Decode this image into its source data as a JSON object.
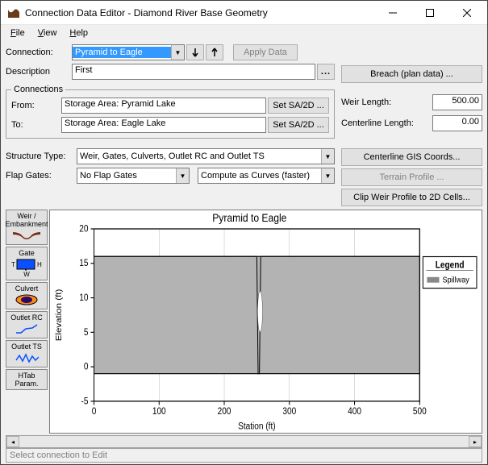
{
  "window": {
    "title": "Connection Data Editor - Diamond River Base Geometry"
  },
  "menu": {
    "file": "File",
    "view": "View",
    "help": "Help"
  },
  "labels": {
    "connection": "Connection:",
    "description": "Description",
    "connections": "Connections",
    "from": "From:",
    "to": "To:",
    "weir_length": "Weir Length:",
    "centerline_length": "Centerline Length:",
    "structure_type": "Structure Type:",
    "flap_gates": "Flap Gates:"
  },
  "fields": {
    "connection": "Pyramid to Eagle",
    "description": "First",
    "from": "Storage Area: Pyramid Lake",
    "to": "Storage Area: Eagle Lake",
    "weir_length": "500.00",
    "centerline_length": "0.00",
    "structure_type": "Weir, Gates, Culverts, Outlet RC and Outlet TS",
    "flap_gates": "No Flap Gates",
    "compute_mode": "Compute as Curves (faster)"
  },
  "buttons": {
    "apply_data": "Apply Data",
    "breach": "Breach (plan data) ...",
    "set_sa2d": "Set SA/2D ...",
    "centerline_gis": "Centerline GIS Coords...",
    "terrain_profile": "Terrain Profile ...",
    "clip_weir": "Clip Weir Profile to 2D Cells..."
  },
  "tools": {
    "weir": "Weir / Embankment",
    "gate": "Gate",
    "culvert": "Culvert",
    "outlet_rc": "Outlet RC",
    "outlet_ts": "Outlet TS",
    "htab": "HTab Param."
  },
  "status": "Select connection to Edit",
  "chart_data": {
    "type": "line",
    "title": "Pyramid to Eagle",
    "xlabel": "Station (ft)",
    "ylabel": "Elevation (ft)",
    "xlim": [
      0,
      500
    ],
    "ylim": [
      -5,
      20
    ],
    "xtick": [
      0,
      100,
      200,
      300,
      400,
      500
    ],
    "ytick": [
      -5,
      0,
      5,
      10,
      15,
      20
    ],
    "series": [
      {
        "name": "Spillway",
        "x": [
          0,
          250,
          252,
          254,
          256,
          258,
          260,
          500
        ],
        "y": [
          16,
          16,
          -1,
          -1,
          16,
          16,
          16,
          16
        ]
      }
    ],
    "fill_rect": {
      "x0": 0,
      "x1": 500,
      "y0": -1,
      "y1": 16
    },
    "legend": {
      "title": "Legend",
      "position": "right"
    }
  }
}
